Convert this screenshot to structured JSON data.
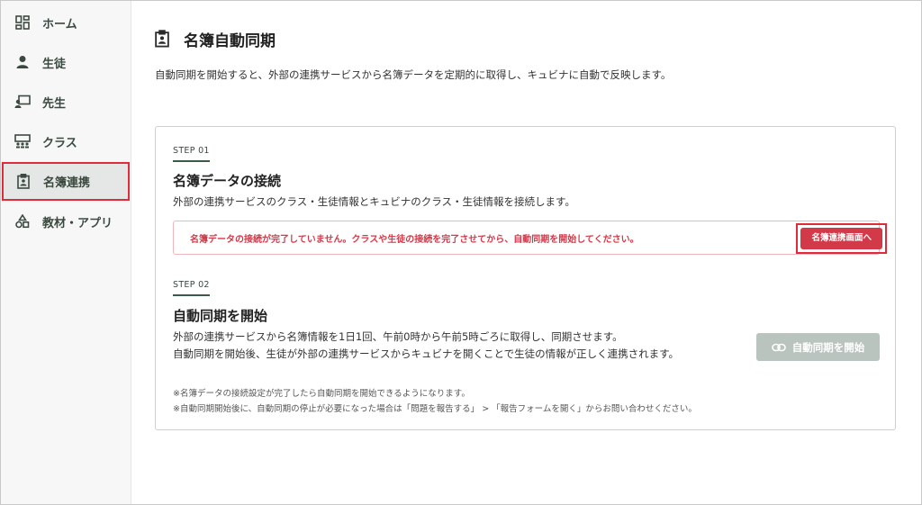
{
  "sidebar": {
    "items": [
      {
        "label": "ホーム",
        "icon": "dashboard-icon"
      },
      {
        "label": "生徒",
        "icon": "person-icon"
      },
      {
        "label": "先生",
        "icon": "teacher-icon"
      },
      {
        "label": "クラス",
        "icon": "classroom-icon"
      },
      {
        "label": "名簿連携",
        "icon": "clipboard-person-icon",
        "active": true
      },
      {
        "label": "教材・アプリ",
        "icon": "shapes-icon"
      }
    ]
  },
  "header": {
    "title": "名簿自動同期",
    "description": "自動同期を開始すると、外部の連携サービスから名簿データを定期的に取得し、キュビナに自動で反映します。"
  },
  "step1": {
    "label": "STEP 01",
    "title": "名簿データの接続",
    "description": "外部の連携サービスのクラス・生徒情報とキュビナのクラス・生徒情報を接続します。",
    "alert_text": "名簿データの接続が完了していません。クラスや生徒の接続を完了させてから、自動同期を開始してください。",
    "alert_button": "名簿連携画面へ"
  },
  "step2": {
    "label": "STEP 02",
    "title": "自動同期を開始",
    "description_line1": "外部の連携サービスから名簿情報を1日1回、午前0時から午前5時ごろに取得し、同期させます。",
    "description_line2": "自動同期を開始後、生徒が外部の連携サービスからキュビナを開くことで生徒の情報が正しく連携されます。",
    "sync_button": "自動同期を開始",
    "sync_button_disabled": true
  },
  "notes": [
    "※名簿データの接続設定が完了したら自動同期を開始できるようになります。",
    "※自動同期開始後に、自動同期の停止が必要になった場合は「問題を報告する」 > 「報告フォームを開く」からお問い合わせください。"
  ],
  "colors": {
    "accent": "#3b5a48",
    "alert": "#d23a4a",
    "highlight": "#e02b3c",
    "disabled": "#b9c4be"
  }
}
